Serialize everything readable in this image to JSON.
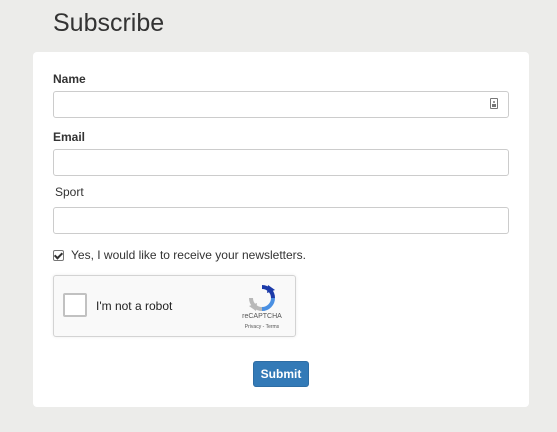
{
  "page": {
    "title": "Subscribe"
  },
  "form": {
    "name_label": "Name",
    "name_value": "",
    "email_label": "Email",
    "email_value": "",
    "sport_label": "Sport",
    "sport_value": "",
    "newsletter_label": "Yes, I would like to receive your newsletters.",
    "newsletter_checked": true,
    "submit_label": "Submit"
  },
  "captcha": {
    "text": "I'm not a robot",
    "brand": "reCAPTCHA",
    "privacy_label": "Privacy",
    "separator": " - ",
    "terms_label": "Terms",
    "checked": false
  },
  "colors": {
    "background": "#ececea",
    "card": "#ffffff",
    "submit_button": "#337ab7",
    "captcha_blue": "#4a90e2",
    "captcha_gray": "#b8b8b8"
  },
  "icons": {
    "name_field": "contact-card-icon",
    "captcha": "recaptcha-logo-icon"
  }
}
